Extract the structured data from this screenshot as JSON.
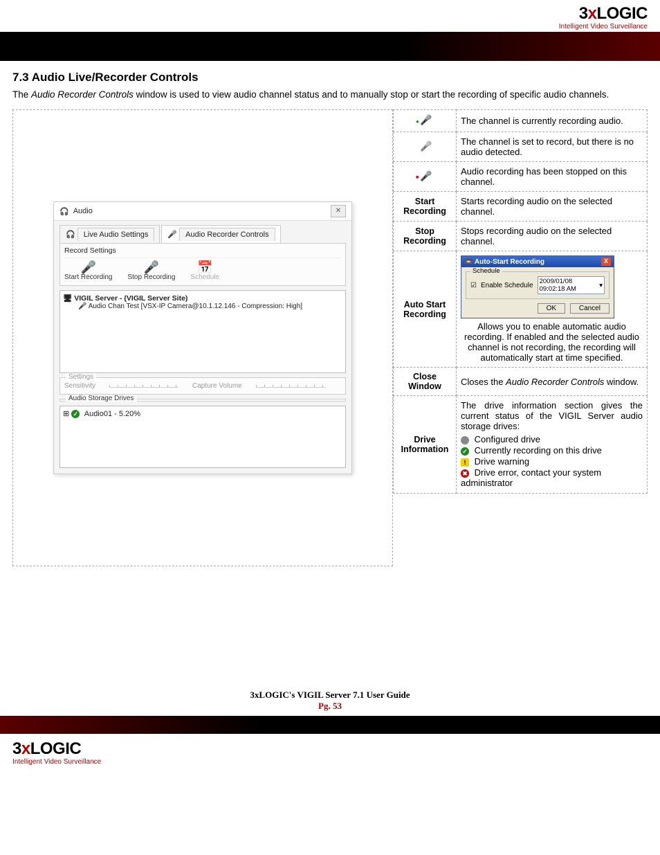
{
  "brand": {
    "name_prefix": "3",
    "name_x": "x",
    "name_suffix": "LOGIC",
    "tagline": "Intelligent Video Surveillance"
  },
  "section": {
    "heading": "7.3 Audio Live/Recorder Controls",
    "intro_prefix": "The ",
    "intro_window_name": "Audio Recorder Controls",
    "intro_suffix": " window is used to view audio channel status and to manually stop or start the recording of specific audio channels."
  },
  "audio_window": {
    "title": "Audio",
    "tab_live": "Live Audio Settings",
    "tab_recorder": "Audio Recorder Controls",
    "record_settings_label": "Record Settings",
    "btn_start": "Start Recording",
    "btn_stop": "Stop Recording",
    "btn_schedule": "Schedule",
    "tree_server": "VIGIL Server - (VIGIL Server Site)",
    "tree_channel": "Audio Chan Test [VSX-IP Camera@10.1.12.146 - Compression: High]",
    "settings_label": "Settings",
    "sensitivity_label": "Sensitivity",
    "capture_label": "Capture Volume",
    "storage_label": "Audio Storage Drives",
    "storage_item": "Audio01 - 5.20%"
  },
  "desc": {
    "row1": "The channel is currently recording audio.",
    "row2": "The channel is set to record, but there is no audio detected.",
    "row3": "Audio recording has been stopped on this channel.",
    "start_label": "Start Recording",
    "start_desc": "Starts recording audio on the selected channel.",
    "stop_label": "Stop Recording",
    "stop_desc": "Stops recording audio on the selected channel.",
    "auto_label": "Auto Start Recording",
    "auto_desc": "Allows you to enable automatic audio recording. If enabled and the selected audio channel is not recording, the recording will automatically start at time specified.",
    "close_label": "Close Window",
    "close_desc_prefix": "Closes the ",
    "close_desc_em": "Audio Recorder Controls",
    "close_desc_suffix": " window.",
    "drive_label": "Drive Information",
    "drive_intro": "The drive information section gives the current status of the VIGIL Server audio storage drives:",
    "drive_configured": "Configured drive",
    "drive_current": "Currently recording on this drive",
    "drive_warning": "Drive warning",
    "drive_error": "Drive error, contact your system administrator"
  },
  "auto_dialog": {
    "title": "Auto-Start Recording",
    "group": "Schedule",
    "checkbox": "Enable Schedule",
    "datetime": "2009/01/08 09:02:18 AM",
    "ok": "OK",
    "cancel": "Cancel"
  },
  "footer": {
    "guide": "3xLOGIC's VIGIL Server 7.1 User Guide",
    "page": "Pg. 53"
  }
}
